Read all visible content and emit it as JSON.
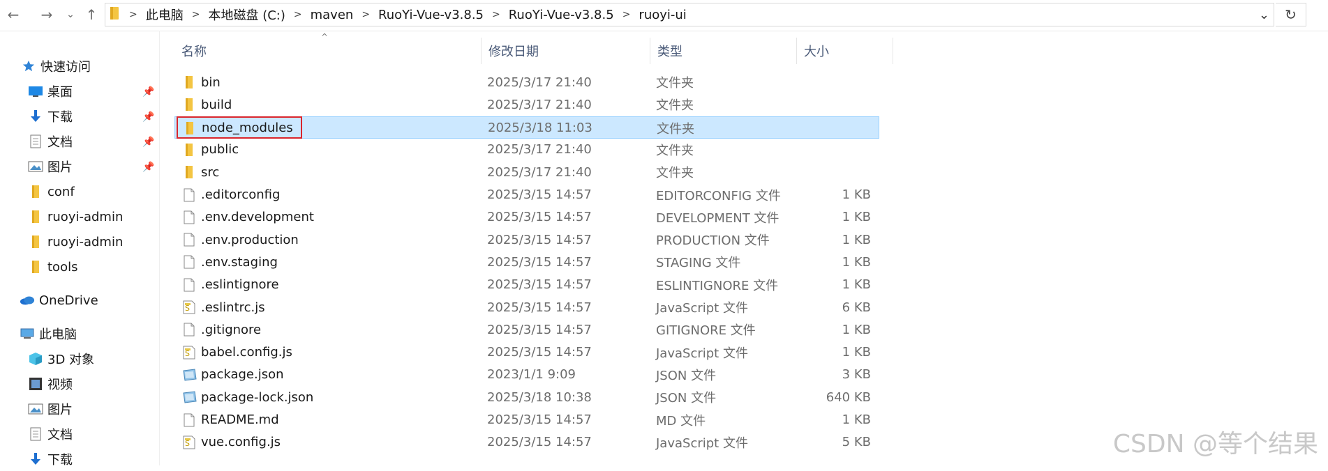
{
  "nav": {
    "back_label": "←",
    "forward_label": "→",
    "recent_label": "⌄",
    "up_label": "↑",
    "refresh_label": "↻",
    "dropdown_label": "⌄"
  },
  "address": {
    "segments": [
      "此电脑",
      "本地磁盘 (C:)",
      "maven",
      "RuoYi-Vue-v3.8.5",
      "RuoYi-Vue-v3.8.5",
      "ruoyi-ui"
    ],
    "separator": ">"
  },
  "sidebar": {
    "quick_access": "快速访问",
    "items": [
      {
        "label": "桌面",
        "icon": "desktop-icon",
        "pinned": true
      },
      {
        "label": "下载",
        "icon": "download-icon",
        "pinned": true
      },
      {
        "label": "文档",
        "icon": "document-icon",
        "pinned": true
      },
      {
        "label": "图片",
        "icon": "picture-icon",
        "pinned": true
      },
      {
        "label": "conf",
        "icon": "folder-icon",
        "pinned": false
      },
      {
        "label": "ruoyi-admin",
        "icon": "folder-icon",
        "pinned": false
      },
      {
        "label": "ruoyi-admin",
        "icon": "folder-icon",
        "pinned": false
      },
      {
        "label": "tools",
        "icon": "folder-icon",
        "pinned": false
      }
    ],
    "onedrive": "OneDrive",
    "this_pc": "此电脑",
    "pc_items": [
      {
        "label": "3D 对象",
        "icon": "3d-objects-icon"
      },
      {
        "label": "视频",
        "icon": "video-icon"
      },
      {
        "label": "图片",
        "icon": "picture-icon"
      },
      {
        "label": "文档",
        "icon": "document-icon"
      },
      {
        "label": "下载",
        "icon": "download-icon"
      }
    ]
  },
  "columns": {
    "name": "名称",
    "date": "修改日期",
    "type": "类型",
    "size": "大小"
  },
  "files": [
    {
      "name": "bin",
      "date": "2025/3/17 21:40",
      "type": "文件夹",
      "size": "",
      "icon": "folder-icon"
    },
    {
      "name": "build",
      "date": "2025/3/17 21:40",
      "type": "文件夹",
      "size": "",
      "icon": "folder-icon"
    },
    {
      "name": "node_modules",
      "date": "2025/3/18 11:03",
      "type": "文件夹",
      "size": "",
      "icon": "folder-icon",
      "selected": true
    },
    {
      "name": "public",
      "date": "2025/3/17 21:40",
      "type": "文件夹",
      "size": "",
      "icon": "folder-icon"
    },
    {
      "name": "src",
      "date": "2025/3/17 21:40",
      "type": "文件夹",
      "size": "",
      "icon": "folder-icon"
    },
    {
      "name": ".editorconfig",
      "date": "2025/3/15 14:57",
      "type": "EDITORCONFIG 文件",
      "size": "1 KB",
      "icon": "file-icon"
    },
    {
      "name": ".env.development",
      "date": "2025/3/15 14:57",
      "type": "DEVELOPMENT 文件",
      "size": "1 KB",
      "icon": "file-icon"
    },
    {
      "name": ".env.production",
      "date": "2025/3/15 14:57",
      "type": "PRODUCTION 文件",
      "size": "1 KB",
      "icon": "file-icon"
    },
    {
      "name": ".env.staging",
      "date": "2025/3/15 14:57",
      "type": "STAGING 文件",
      "size": "1 KB",
      "icon": "file-icon"
    },
    {
      "name": ".eslintignore",
      "date": "2025/3/15 14:57",
      "type": "ESLINTIGNORE 文件",
      "size": "1 KB",
      "icon": "file-icon"
    },
    {
      "name": ".eslintrc.js",
      "date": "2025/3/15 14:57",
      "type": "JavaScript 文件",
      "size": "6 KB",
      "icon": "js-file-icon"
    },
    {
      "name": ".gitignore",
      "date": "2025/3/15 14:57",
      "type": "GITIGNORE 文件",
      "size": "1 KB",
      "icon": "file-icon"
    },
    {
      "name": "babel.config.js",
      "date": "2025/3/15 14:57",
      "type": "JavaScript 文件",
      "size": "1 KB",
      "icon": "js-file-icon"
    },
    {
      "name": "package.json",
      "date": "2023/1/1 9:09",
      "type": "JSON 文件",
      "size": "3 KB",
      "icon": "json-file-icon"
    },
    {
      "name": "package-lock.json",
      "date": "2025/3/18 10:38",
      "type": "JSON 文件",
      "size": "640 KB",
      "icon": "json-file-icon"
    },
    {
      "name": "README.md",
      "date": "2025/3/15 14:57",
      "type": "MD 文件",
      "size": "1 KB",
      "icon": "file-icon"
    },
    {
      "name": "vue.config.js",
      "date": "2025/3/15 14:57",
      "type": "JavaScript 文件",
      "size": "5 KB",
      "icon": "js-file-icon"
    }
  ],
  "watermark": "CSDN @等个结果",
  "colors": {
    "selection_bg": "#cce8ff",
    "selection_border": "#99d1ff",
    "highlight_box": "#d9262d",
    "folder_yellow": "#f4c542",
    "header_text": "#4a5a78"
  }
}
